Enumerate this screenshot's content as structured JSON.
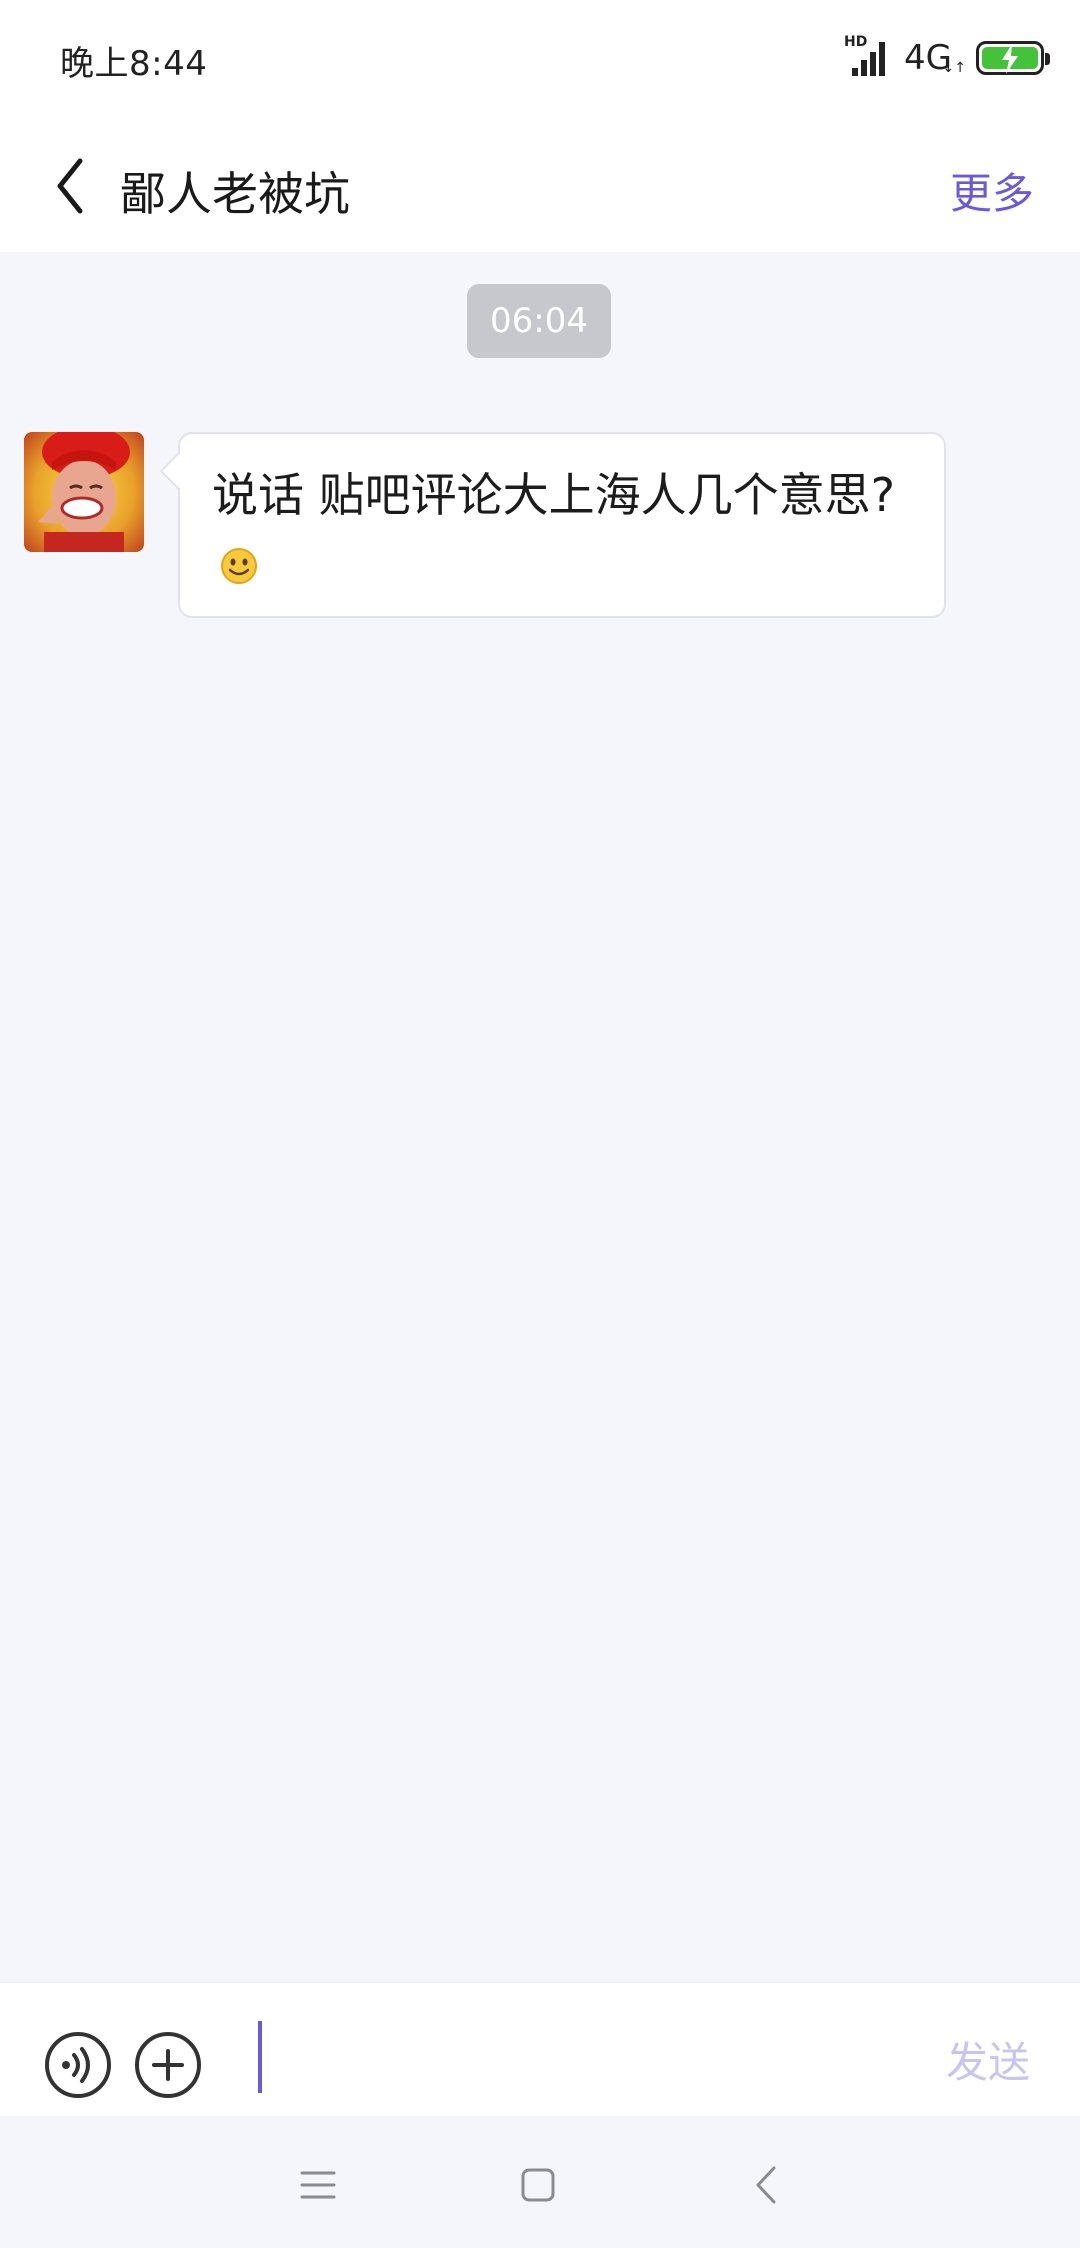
{
  "status_bar": {
    "time": "晚上8:44",
    "hd": "HD",
    "network": "4G",
    "network_arrows": "↓↑"
  },
  "header": {
    "title": "鄙人老被坑",
    "more_label": "更多"
  },
  "chat": {
    "timestamp": "06:04",
    "messages": [
      {
        "text": "说话  贴吧评论大上海人几个意思?",
        "has_emoji": true,
        "emoji": "smile-emoji"
      }
    ]
  },
  "input_bar": {
    "value": "",
    "send_label": "发送"
  },
  "colors": {
    "accent": "#6b5ad8",
    "send_disabled": "#c9c4f0",
    "chat_background": "#f5f6fc",
    "timestamp_background": "#c7c8cd",
    "battery": "#43c23a"
  }
}
